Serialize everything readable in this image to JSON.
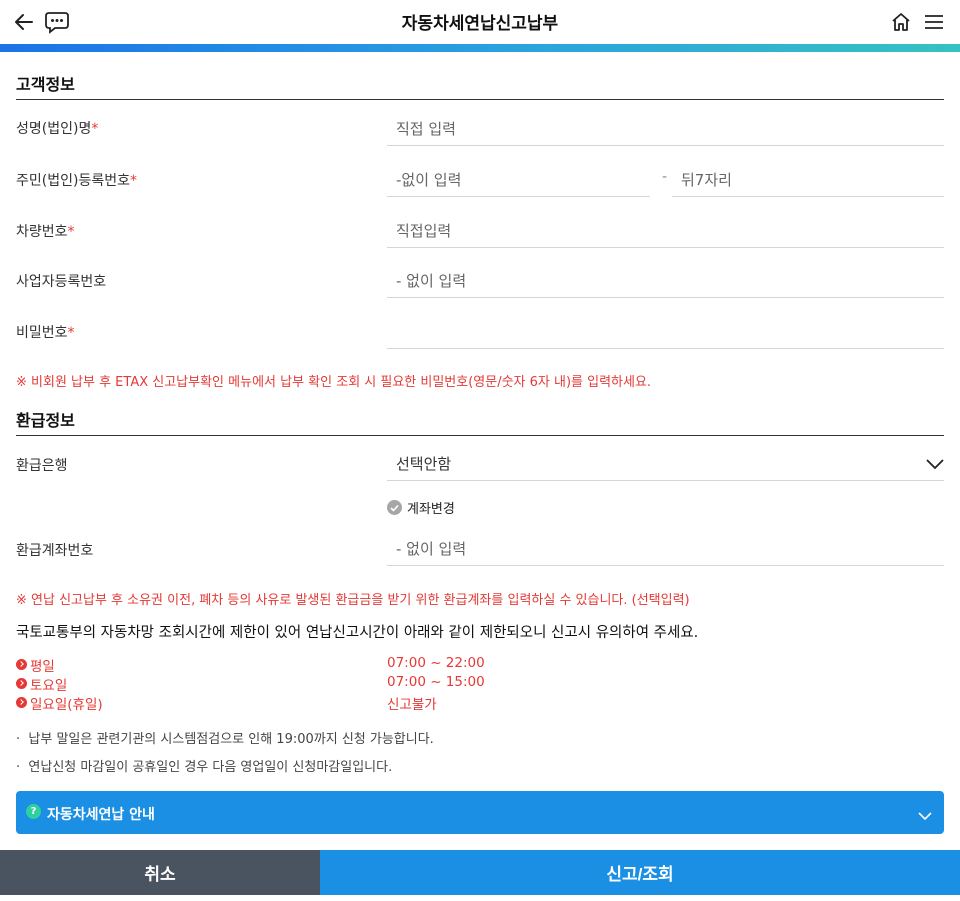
{
  "header": {
    "title": "자동차세연납신고납부",
    "back_icon": "back-arrow-icon",
    "chat_icon": "chat-bubble-icon",
    "home_icon": "home-icon",
    "menu_icon": "hamburger-menu-icon"
  },
  "customer": {
    "section_title": "고객정보",
    "name_label": "성명(법인)명",
    "name_placeholder": "직접 입력",
    "rrn_label": "주민(법인)등록번호",
    "rrn_front_placeholder": "-없이 입력",
    "rrn_separator": "-",
    "rrn_back_placeholder": "뒤7자리",
    "car_label": "차량번호",
    "car_placeholder": "직접입력",
    "biz_label": "사업자등록번호",
    "biz_placeholder": "- 없이 입력",
    "pw_label": "비밀번호",
    "pw_placeholder": "",
    "required_mark": "*",
    "pw_notice": "※ 비회원 납부 후 ETAX 신고납부확인 메뉴에서 납부 확인 조회 시 필요한 비밀번호(영문/숫자 6자 내)를 입력하세요."
  },
  "refund": {
    "section_title": "환급정보",
    "bank_label": "환급은행",
    "bank_selected": "선택안함",
    "account_change_label": "계좌변경",
    "account_label": "환급계좌번호",
    "account_placeholder": "- 없이 입력",
    "notice": "※ 연납 신고납부 후 소유권 이전, 폐차 등의 사유로 발생된 환급금을 받기 위한 환급계좌를 입력하실 수 있습니다. (선택입력)"
  },
  "schedule": {
    "intro": "국토교통부의 자동차망 조회시간에 제한이 있어 연납신고시간이 아래와 같이 제한되오니 신고시 유의하여 주세요.",
    "rows": [
      {
        "day": "평일",
        "time": "07:00 ~ 22:00"
      },
      {
        "day": "토요일",
        "time": "07:00 ~ 15:00"
      },
      {
        "day": "일요일(휴일)",
        "time": "신고불가"
      }
    ],
    "bullets": [
      "납부 말일은 관련기관의 시스템점검으로 인해 19:00까지 신청 가능합니다.",
      "연납신청 마감일이 공휴일인 경우 다음 영업일이 신청마감일입니다."
    ],
    "bullet_mark": "·"
  },
  "guide": {
    "icon_text": "?",
    "label": "자동차세연납 안내"
  },
  "footer": {
    "cancel_label": "취소",
    "submit_label": "신고/조회"
  },
  "colors": {
    "accent": "#1a8fe3",
    "required": "#e53935",
    "cancel_bg": "#4a5360"
  }
}
